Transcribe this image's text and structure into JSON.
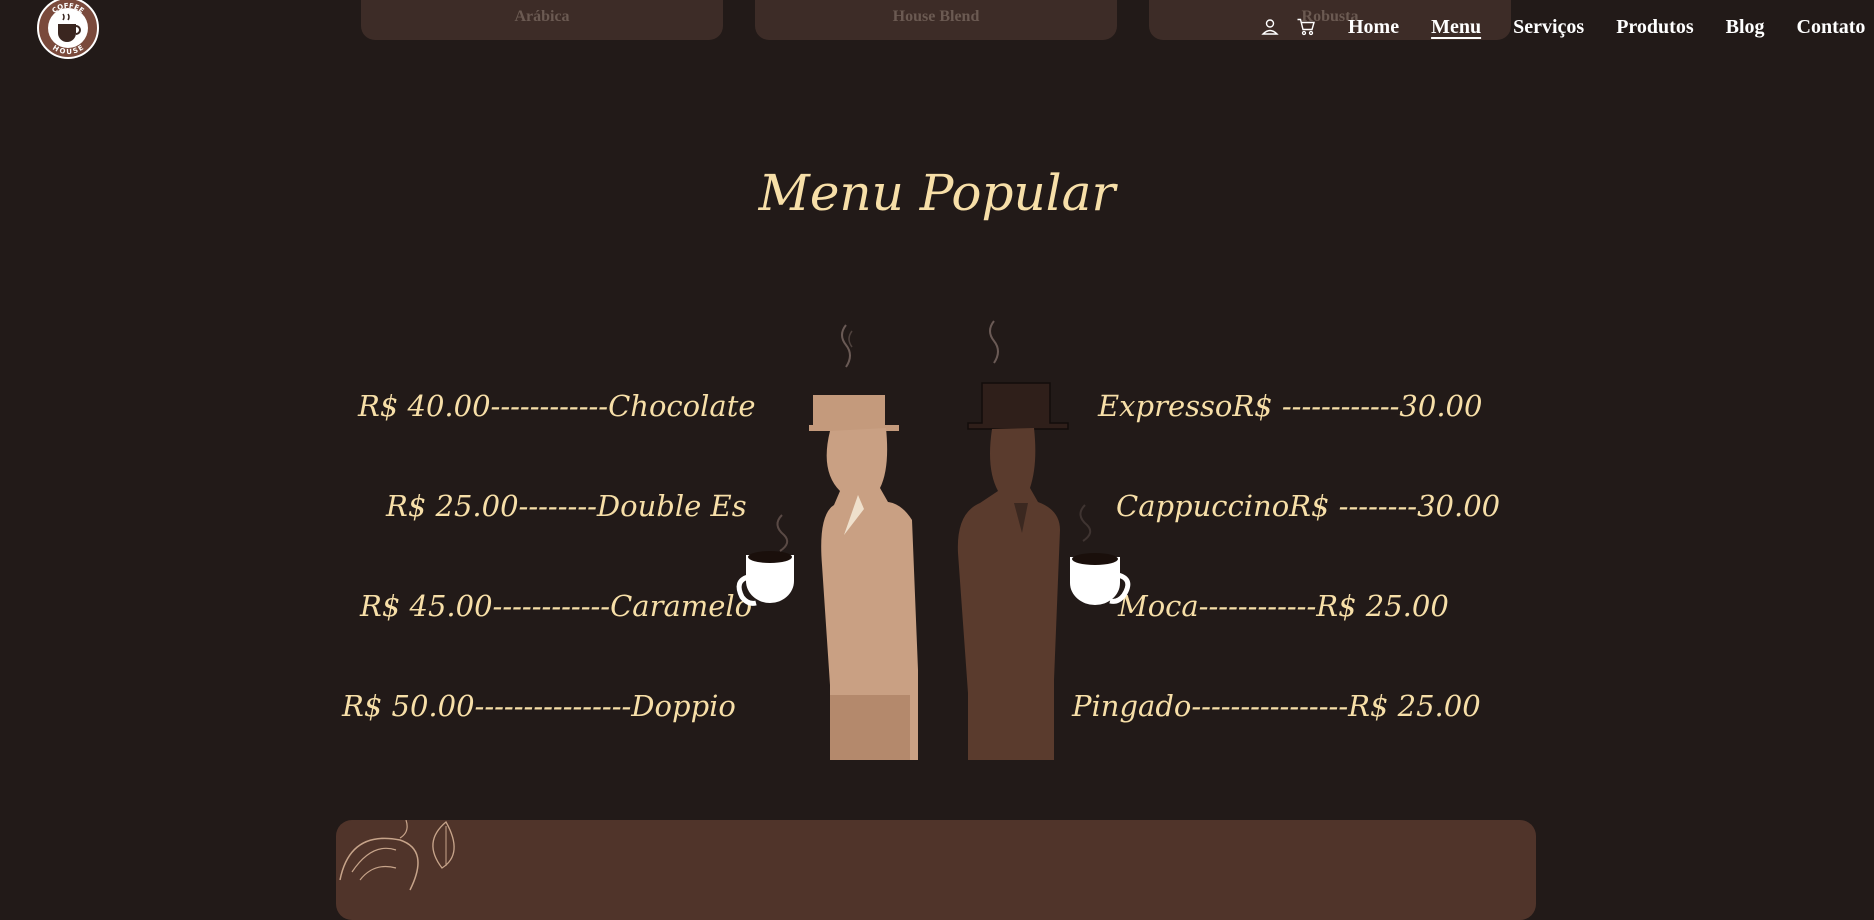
{
  "top_cards": [
    "Arábica",
    "House Blend",
    "Robusta"
  ],
  "header": {
    "logo_text_top": "COFFEE",
    "logo_text_bottom": "HOUSE",
    "nav": [
      "Home",
      "Menu",
      "Serviços",
      "Produtos",
      "Blog",
      "Contato"
    ],
    "active_nav": "Menu",
    "icons": [
      "user-icon",
      "cart-icon"
    ]
  },
  "menu": {
    "title": "Menu Popular",
    "left": [
      "R$ 40.00------------Chocolate",
      "R$ 25.00--------Double Es",
      "R$ 45.00------------Caramelo",
      "R$ 50.00----------------Doppio"
    ],
    "right": [
      "ExpressoR$ ------------30.00",
      "CappuccinoR$ --------30.00",
      "Moca------------R$ 25.00",
      "Pingado----------------R$ 25.00"
    ]
  },
  "colors": {
    "background": "#221a18",
    "accent_text": "#f7dfa8",
    "card": "#3d2c27",
    "panel": "#50342a"
  }
}
